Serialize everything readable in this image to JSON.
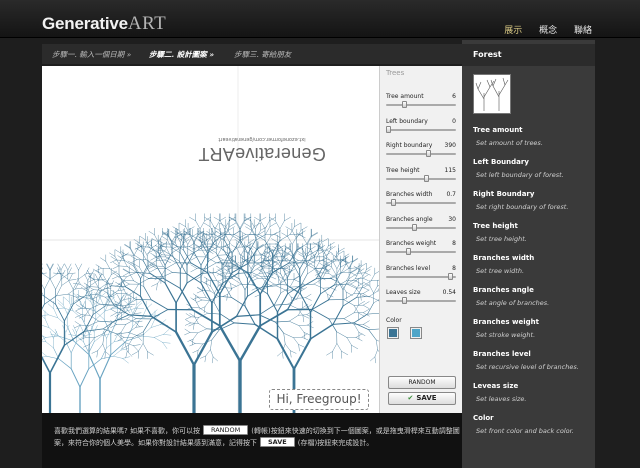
{
  "header": {
    "logo_main": "Generative",
    "logo_accent": "ART",
    "nav": [
      "展示",
      "概念",
      "聯絡"
    ]
  },
  "steps": [
    "步驟一. 輸入一個日期 »",
    "步驟二. 設計圖案 »",
    "步驟三. 寄給朋友"
  ],
  "canvas": {
    "mirror_title": "GenerativeART",
    "mirror_sub": "ixt.ezoneformer.com/generativeart",
    "signature": "Hi, Freegroup!"
  },
  "controls": {
    "title": "Trees",
    "sliders": [
      {
        "label": "Tree amount",
        "value": "6",
        "pos": 0.25
      },
      {
        "label": "Left boundary",
        "value": "0",
        "pos": 0.0
      },
      {
        "label": "Right boundary",
        "value": "390",
        "pos": 0.62
      },
      {
        "label": "Tree height",
        "value": "115",
        "pos": 0.58
      },
      {
        "label": "Branches width",
        "value": "0.7",
        "pos": 0.08
      },
      {
        "label": "Branches angle",
        "value": "30",
        "pos": 0.4
      },
      {
        "label": "Branches weight",
        "value": "8",
        "pos": 0.3
      },
      {
        "label": "Branches level",
        "value": "8",
        "pos": 0.95
      },
      {
        "label": "Leaves size",
        "value": "0.54",
        "pos": 0.25
      }
    ],
    "color_label": "Color",
    "front_color": "#3b7494",
    "back_color": "#4ea5c8",
    "random_label": "RANDOM",
    "save_label": "SAVE"
  },
  "bottom": {
    "line1_pre": "喜歡我們選算的結果嗎? 如果不喜歡，你可以按",
    "line1_btn": "RANDOM",
    "line1_post": "(轉帳)按鈕來快速的切換到下一個圖案，或是拖曳滑桿來互動調整圖",
    "line2_pre": "案，來符合你的個人美學。如果你對設計結果感到滿意，記得按下",
    "line2_btn": "SAVE",
    "line2_post": "(存檔)按鈕來完成設計。"
  },
  "sidebar": {
    "title": "Forest",
    "items": [
      {
        "h": "Tree amount",
        "d": "Set amount of trees."
      },
      {
        "h": "Left Boundary",
        "d": "Set left boundary of forest."
      },
      {
        "h": "Right Boundary",
        "d": "Set right boundary of forest."
      },
      {
        "h": "Tree height",
        "d": "Set tree height."
      },
      {
        "h": "Branches width",
        "d": "Set tree width."
      },
      {
        "h": "Branches angle",
        "d": "Set angle of branches."
      },
      {
        "h": "Branches weight",
        "d": "Set stroke weight."
      },
      {
        "h": "Branches level",
        "d": "Set recursive level of branches."
      },
      {
        "h": "Leveas size",
        "d": "Set leaves size."
      },
      {
        "h": "Color",
        "d": "Set front color and back color."
      }
    ]
  },
  "colors": {
    "tree": "#3b7494",
    "tree_light": "#6aa4c2",
    "nav_active": "#d8c884"
  }
}
